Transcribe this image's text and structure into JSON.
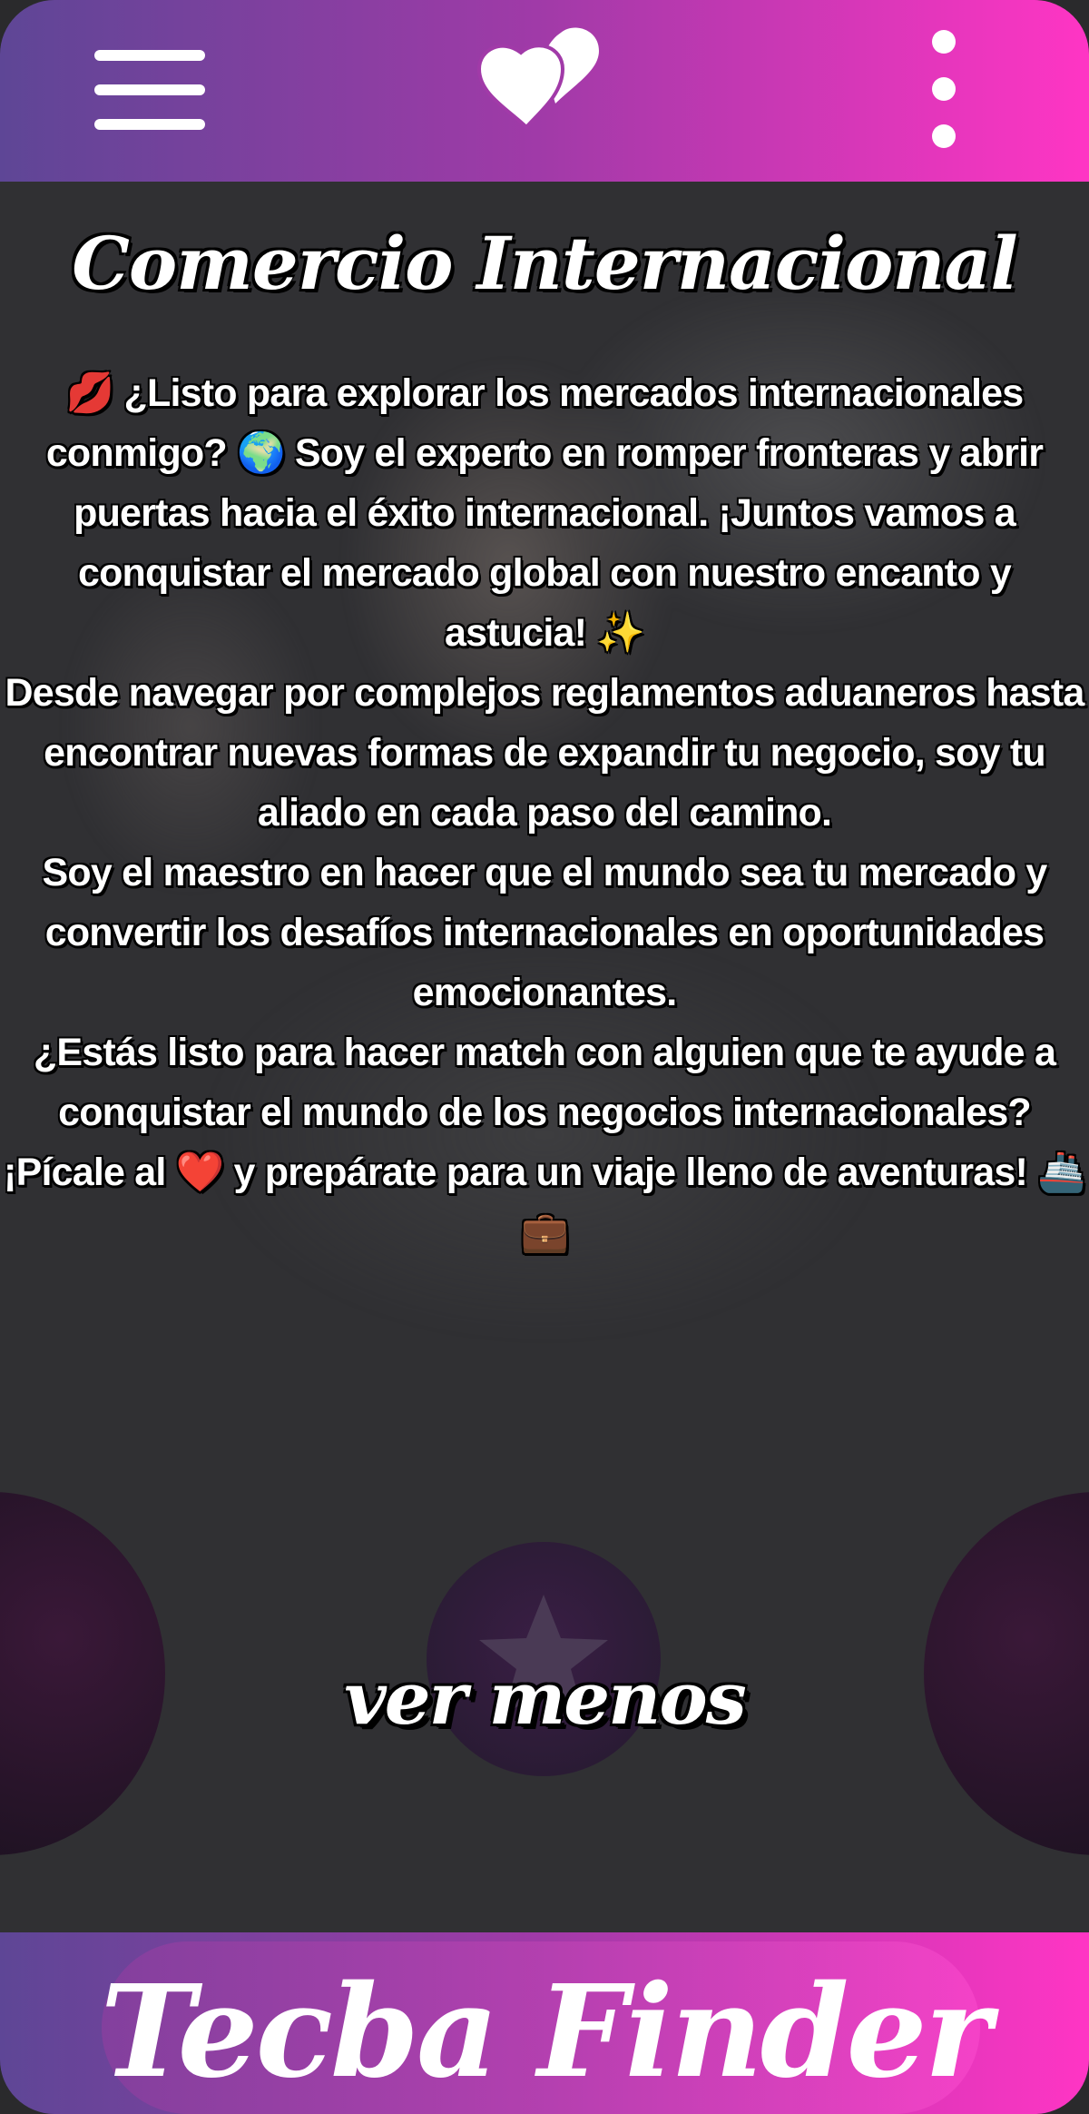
{
  "header": {
    "menu_icon": "hamburger-menu-icon",
    "logo_icon": "two-hearts-logo-icon",
    "more_icon": "vertical-dots-icon"
  },
  "profile": {
    "title": "Comercio Internacional",
    "bio": [
      "💋 ¿Listo para explorar los mercados internacionales conmigo? 🌍 Soy el experto en romper fronteras y abrir puertas hacia el éxito internacional.  ¡Juntos vamos a conquistar el mercado global con nuestro encanto y astucia! ✨",
      "Desde navegar por complejos reglamentos aduaneros hasta encontrar nuevas formas de expandir tu negocio, soy tu aliado en cada paso del camino.",
      "Soy el maestro en hacer que el mundo sea tu mercado y convertir los desafíos internacionales en oportunidades emocionantes.",
      "¿Estás listo para hacer match con alguien que te ayude a conquistar el mundo de los negocios internacionales? ¡Pícale al ❤️ y prepárate para un viaje lleno de aventuras! 🚢💼"
    ]
  },
  "actions": {
    "ver_menos": "ver menos",
    "star_icon": "star-icon"
  },
  "footer": {
    "brand": "Tecba Finder"
  },
  "colors": {
    "gradient_start": "#5e4696",
    "gradient_end": "#ff35c4",
    "background": "#303033"
  }
}
